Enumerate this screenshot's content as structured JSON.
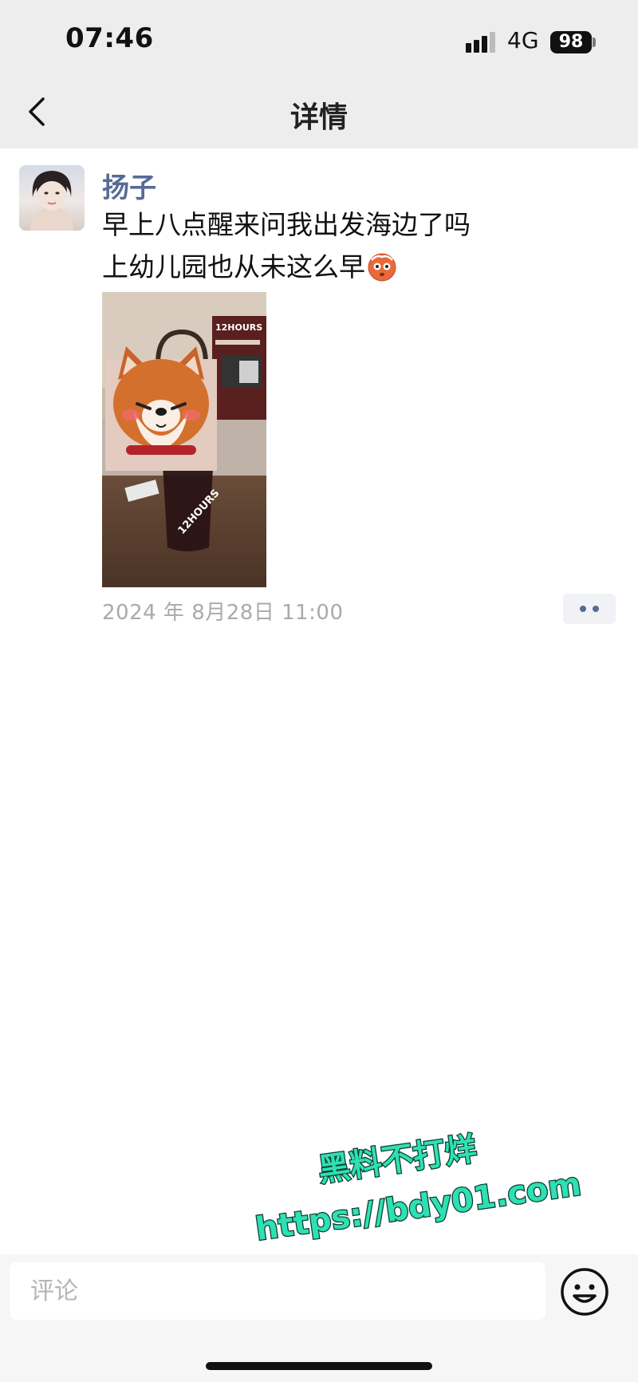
{
  "status_bar": {
    "time": "07:46",
    "network": "4G",
    "battery": "98"
  },
  "nav": {
    "title": "详情"
  },
  "post": {
    "author": "扬子",
    "text_lines": [
      "早上八点醒来问我出发海边了吗",
      "上幼儿园也从未这么早"
    ],
    "inline_emoji": "dizzy-face-emoji",
    "photo_texts": {
      "sign": "12HOURS",
      "cup": "12HOURS"
    },
    "timestamp": "2024 年 8月28日 11:00"
  },
  "watermark": {
    "line1": "黑料不打烊",
    "line2": "https://bdy01.com"
  },
  "comment_bar": {
    "placeholder": "评论"
  },
  "icons": {
    "back": "chevron-left-icon",
    "signal": "cellular-signal-icon",
    "battery": "battery-icon",
    "more": "more-dots-icon",
    "emoji": "smiley-icon"
  },
  "colors": {
    "header_bg": "#ededed",
    "username": "#576b95",
    "timestamp": "#aaaaaa",
    "watermark_fill": "#2ee0b3"
  }
}
